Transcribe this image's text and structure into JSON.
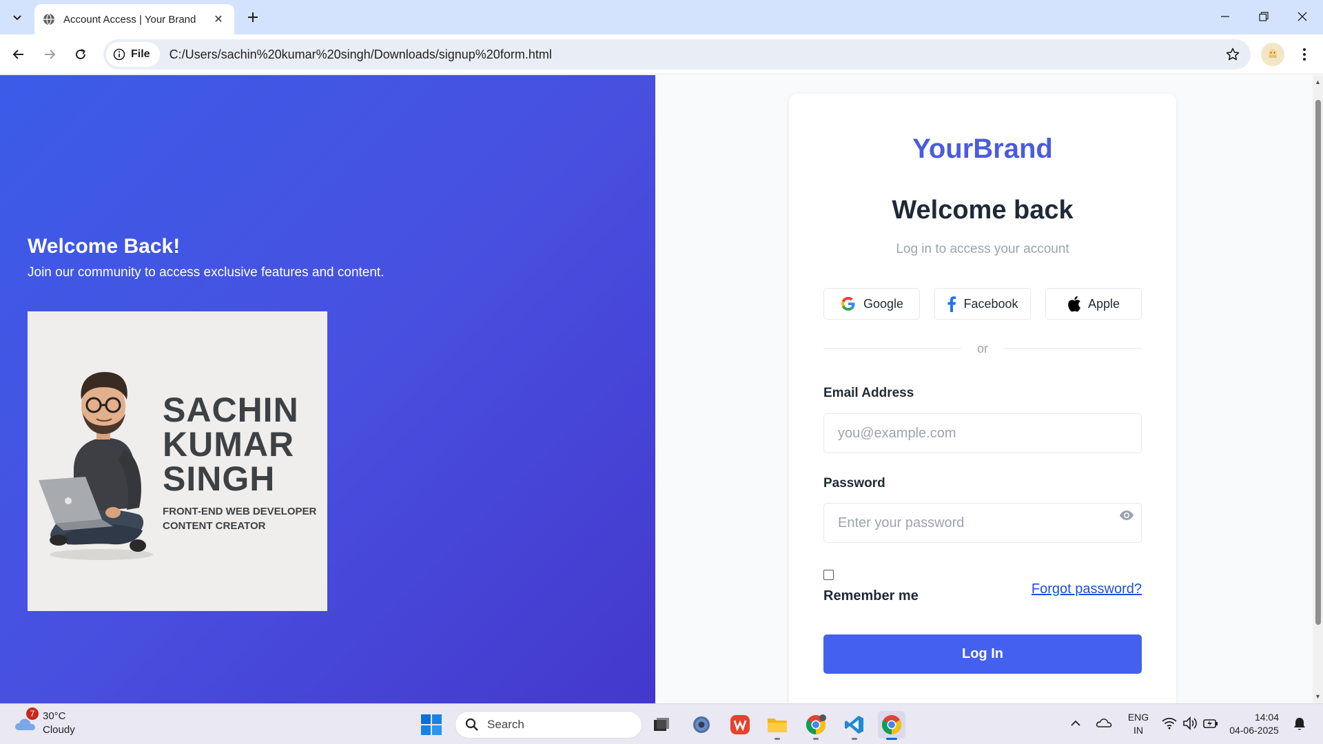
{
  "browser": {
    "tab_title": "Account Access | Your Brand",
    "file_chip": "File",
    "url": "C:/Users/sachin%20kumar%20singh/Downloads/signup%20form.html"
  },
  "hero": {
    "title": "Welcome Back!",
    "subtitle": "Join our community to access exclusive features and content.",
    "card_name_line1": "SACHIN",
    "card_name_line2": "KUMAR",
    "card_name_line3": "SINGH",
    "card_role_line1": "FRONT-END WEB DEVELOPER",
    "card_role_line2": "CONTENT CREATOR"
  },
  "login": {
    "brand": "YourBrand",
    "title": "Welcome back",
    "subtitle": "Log in to access your account",
    "social": {
      "google": "Google",
      "facebook": "Facebook",
      "apple": "Apple"
    },
    "divider": "or",
    "email_label": "Email Address",
    "email_placeholder": "you@example.com",
    "password_label": "Password",
    "password_placeholder": "Enter your password",
    "remember": "Remember me",
    "forgot": "Forgot password?",
    "submit": "Log In"
  },
  "taskbar": {
    "weather_temp": "30°C",
    "weather_cond": "Cloudy",
    "weather_badge": "7",
    "search_label": "Search",
    "lang_line1": "ENG",
    "lang_line2": "IN",
    "time": "14:04",
    "date": "04-06-2025"
  },
  "colors": {
    "brand": "#4a5be0",
    "primary_button": "#4361ee",
    "hero_gradient_start": "#3b5ce8",
    "hero_gradient_end": "#4438cc"
  }
}
